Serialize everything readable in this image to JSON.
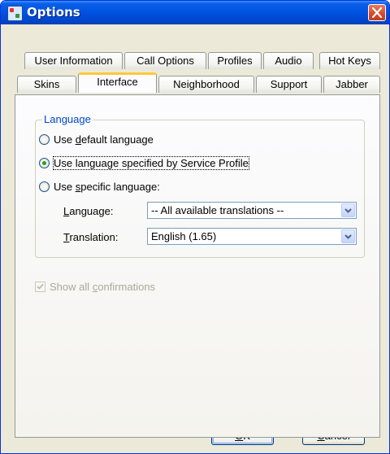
{
  "window": {
    "title": "Options",
    "app_icon": "app-options-icon",
    "close_icon": "close-icon",
    "colors": {
      "titlebar": "#0054e3",
      "face": "#ece9d8",
      "close": "#d8472a",
      "groupTitle": "#0046d5",
      "tabHighlight": "#ffc83c"
    }
  },
  "tabs": {
    "row1": [
      "User Information",
      "Call Options",
      "Profiles",
      "Audio",
      "Hot Keys"
    ],
    "row2": [
      "Skins",
      "Interface",
      "Neighborhood",
      "Support",
      "Jabber"
    ],
    "active": "Interface"
  },
  "language_group": {
    "title": "Language",
    "options": {
      "default": {
        "pre": "Use ",
        "key": "d",
        "post": "efault language",
        "selected": false
      },
      "profile": {
        "pre": "Use language specified by Service Profile",
        "key": "",
        "post": "",
        "selected": true
      },
      "specific": {
        "pre": "Use ",
        "key": "s",
        "post": "pecific language:",
        "selected": false
      }
    },
    "language_field": {
      "key": "L",
      "label_rest": "anguage:",
      "value": "-- All available translations --"
    },
    "translation_field": {
      "key": "T",
      "label_rest": "ranslation:",
      "value": "English (1.65)"
    }
  },
  "confirmations": {
    "pre": "Show all ",
    "key": "c",
    "post": "onfirmations",
    "checked": true,
    "enabled": false
  },
  "buttons": {
    "ok": {
      "key": "O",
      "rest": "K"
    },
    "cancel": {
      "key": "C",
      "rest": "ancel"
    }
  }
}
